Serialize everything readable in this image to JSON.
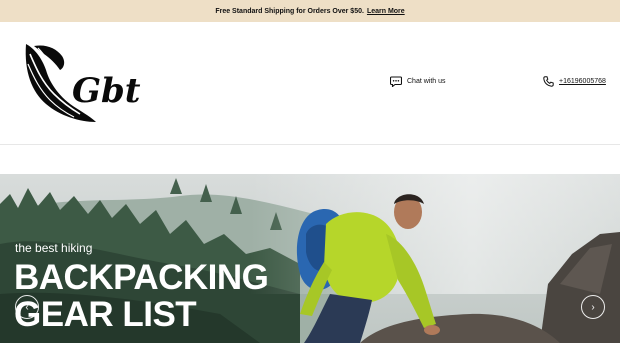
{
  "announcement": {
    "text": "Free Standard Shipping for Orders Over $50.",
    "link_label": "Learn More"
  },
  "header": {
    "logo_text": "Gbt",
    "chat_label": "Chat with us",
    "phone_number": "+16196005768"
  },
  "hero": {
    "subtitle": "the best hiking",
    "title_line1": "BACKPACKING",
    "title_line2": "GEAR LIST",
    "prev_glyph": "‹",
    "next_glyph": "›"
  },
  "icons": [
    "chat-bubble-icon",
    "phone-icon",
    "chevron-left-icon",
    "chevron-right-icon"
  ],
  "colors": {
    "announcement_bg": "#eedfc6",
    "text": "#111111",
    "jacket": "#b6d62a",
    "backpack": "#2a67b1"
  }
}
